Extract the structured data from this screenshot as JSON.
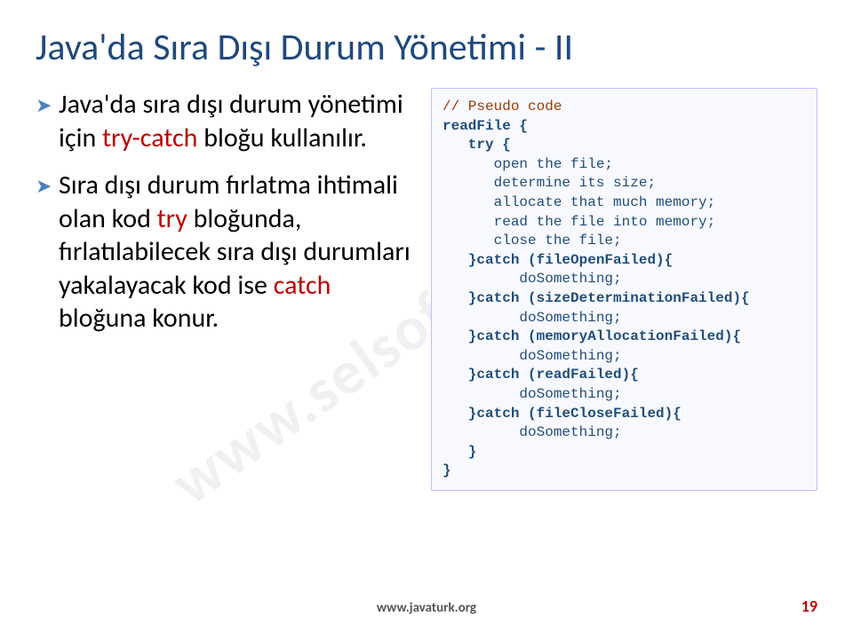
{
  "title": "Java'da Sıra Dışı Durum Yönetimi - II",
  "bullets": [
    {
      "pre": "Java'da sıra dışı durum yönetimi için ",
      "kw": "try-catch",
      "post": " bloğu kullanılır."
    },
    {
      "pre": "Sıra dışı durum fırlatma ihtimali olan kod ",
      "try": "try",
      "mid": " bloğunda, fırlatılabilecek sıra dışı durumları yakalayacak kod ise ",
      "catch": "catch",
      "post": " bloğuna konur."
    }
  ],
  "code": {
    "l1": "// Pseudo code",
    "l2": "readFile {",
    "l3": "   try {",
    "l4": "      open the file;",
    "l5": "      determine its size;",
    "l6": "      allocate that much memory;",
    "l7": "      read the file into memory;",
    "l8": "      close the file;",
    "l9": "   }catch (fileOpenFailed){",
    "l10": "         doSomething;",
    "l11": "   }catch (sizeDeterminationFailed){",
    "l12": "         doSomething;",
    "l13": "   }catch (memoryAllocationFailed){",
    "l14": "         doSomething;",
    "l15": "   }catch (readFailed){",
    "l16": "         doSomething;",
    "l17": "   }catch (fileCloseFailed){",
    "l18": "         doSomething;",
    "l19": "   }",
    "l20": "}"
  },
  "watermark": "www.selsoft.academy",
  "footer": "www.javaturk.org",
  "page": "19"
}
